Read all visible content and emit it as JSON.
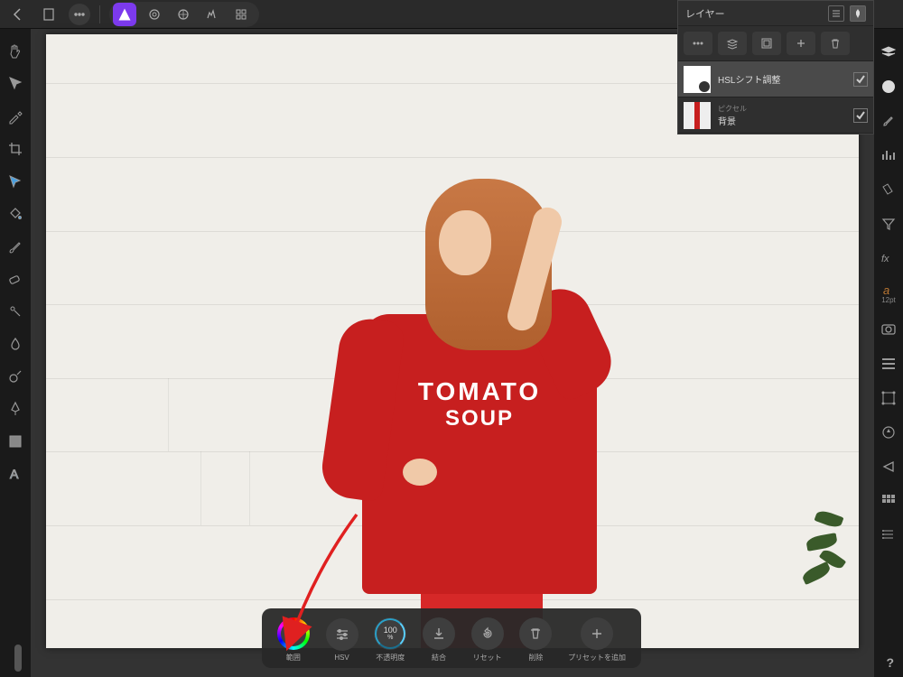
{
  "layers_panel": {
    "title": "レイヤー",
    "items": [
      {
        "type": "",
        "name": "HSLシフト調整",
        "selected": true,
        "thumb": "adj"
      },
      {
        "type": "ピクセル",
        "name": "背景",
        "selected": false,
        "thumb": "pixel"
      }
    ]
  },
  "photo": {
    "text_line1": "TOMATO",
    "text_line2": "SOUP"
  },
  "adjustments": {
    "items": [
      {
        "id": "range",
        "label": "範囲",
        "kind": "wheel"
      },
      {
        "id": "hsv",
        "label": "HSV",
        "kind": "sliders"
      },
      {
        "id": "opacity",
        "label": "不透明度",
        "kind": "ring",
        "value_top": "100",
        "value_bot": "%"
      },
      {
        "id": "merge",
        "label": "結合",
        "kind": "merge"
      },
      {
        "id": "reset",
        "label": "リセット",
        "kind": "reset"
      },
      {
        "id": "delete",
        "label": "削除",
        "kind": "delete"
      },
      {
        "id": "preset",
        "label": "プリセットを追加",
        "kind": "plus"
      }
    ]
  },
  "right_text": {
    "font_size": "12pt"
  },
  "help": "?"
}
